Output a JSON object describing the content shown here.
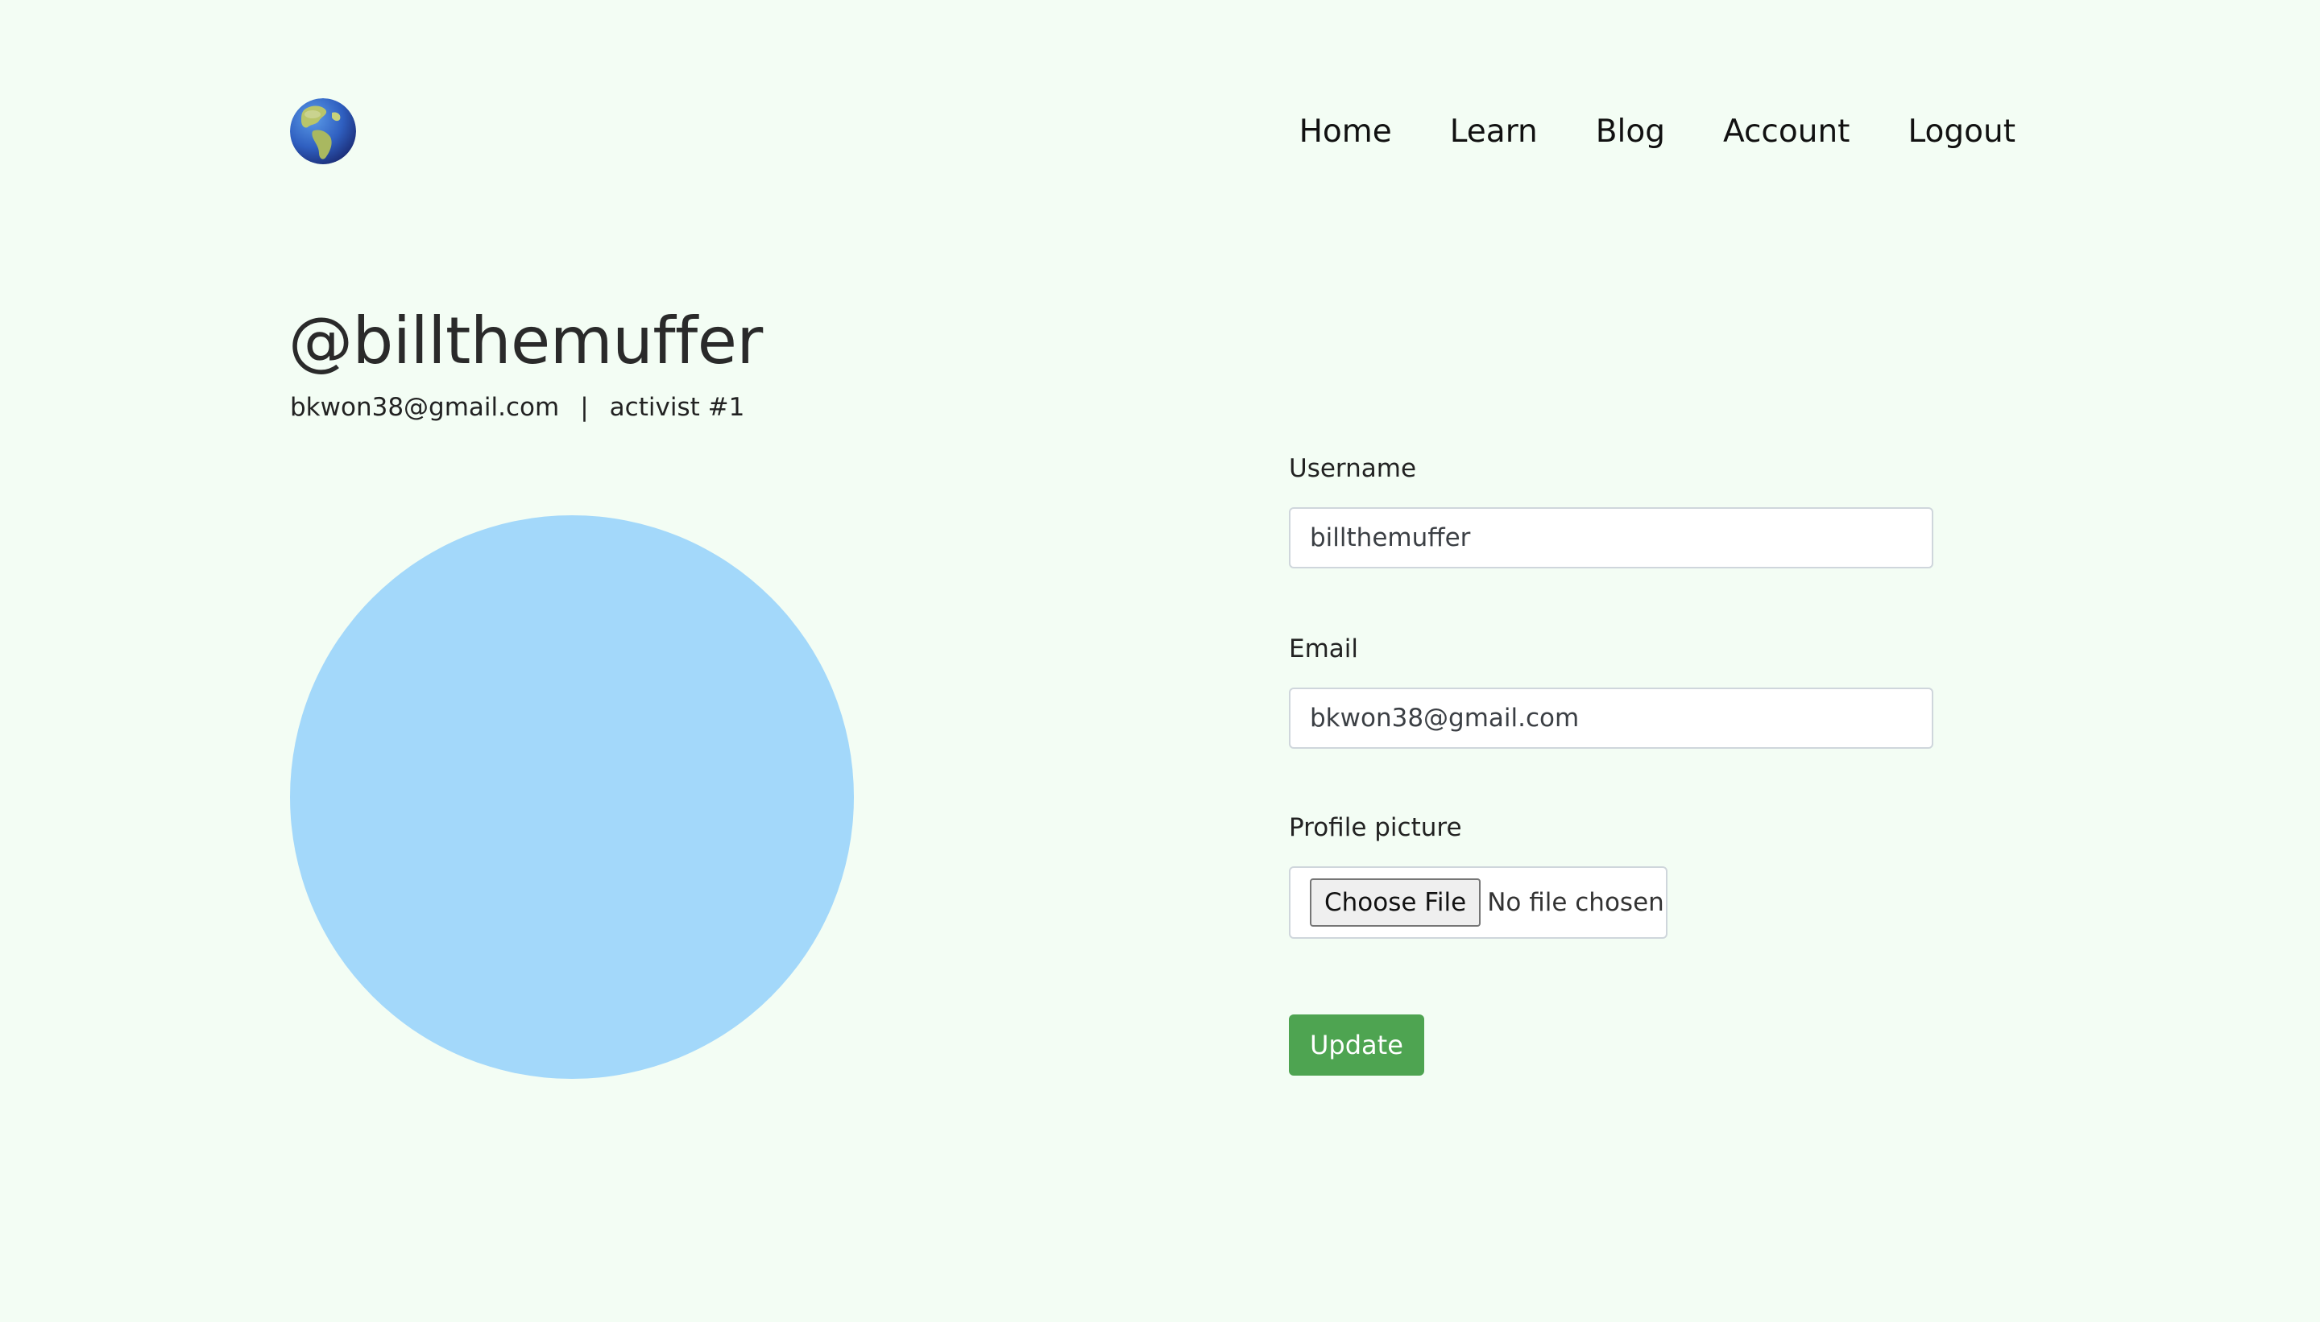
{
  "header": {
    "logo_icon": "globe-americas-icon",
    "nav": [
      {
        "label": "Home"
      },
      {
        "label": "Learn"
      },
      {
        "label": "Blog"
      },
      {
        "label": "Account"
      },
      {
        "label": "Logout"
      }
    ]
  },
  "profile": {
    "handle": "@billthemuffer",
    "email": "bkwon38@gmail.com",
    "separator": "|",
    "rank": "activist #1",
    "avatar_color": "#a3d8fa"
  },
  "form": {
    "username_label": "Username",
    "username_value": "billthemuffer",
    "email_label": "Email",
    "email_value": "bkwon38@gmail.com",
    "picture_label": "Profile picture",
    "choose_file_label": "Choose File",
    "no_file_text": "No file chosen",
    "update_label": "Update",
    "update_color": "#4ea451"
  },
  "colors": {
    "background": "#f3fdf4"
  }
}
